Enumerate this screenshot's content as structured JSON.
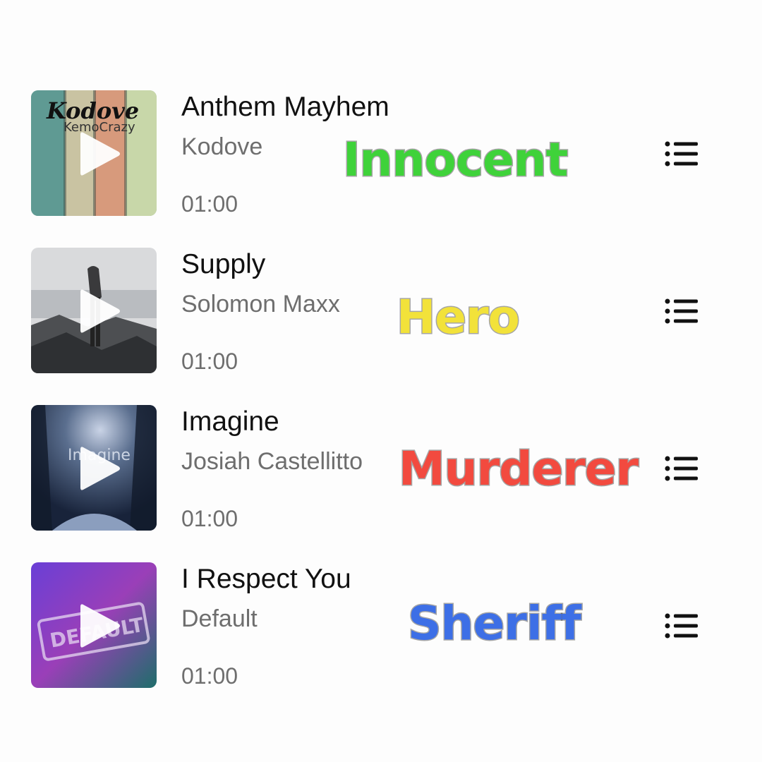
{
  "tracks": [
    {
      "title": "Anthem Mayhem",
      "artist": "Kodove",
      "duration": "01:00",
      "role": "Innocent",
      "role_color": "#3fd23a",
      "cover_text": "Kodove",
      "cover_subtext": "KemoCrazy"
    },
    {
      "title": "Supply",
      "artist": "Solomon Maxx",
      "duration": "01:00",
      "role": "Hero",
      "role_color": "#f2e23a"
    },
    {
      "title": "Imagine",
      "artist": "Josiah Castellitto",
      "duration": "01:00",
      "role": "Murderer",
      "role_color": "#f24a3f",
      "cover_text": "Imagine"
    },
    {
      "title": "I Respect You",
      "artist": "Default",
      "duration": "01:00",
      "role": "Sheriff",
      "role_color": "#3d6fe6",
      "cover_text": "DEFAULT"
    }
  ],
  "icons": {
    "play": "play-icon",
    "menu": "list-menu-icon"
  }
}
